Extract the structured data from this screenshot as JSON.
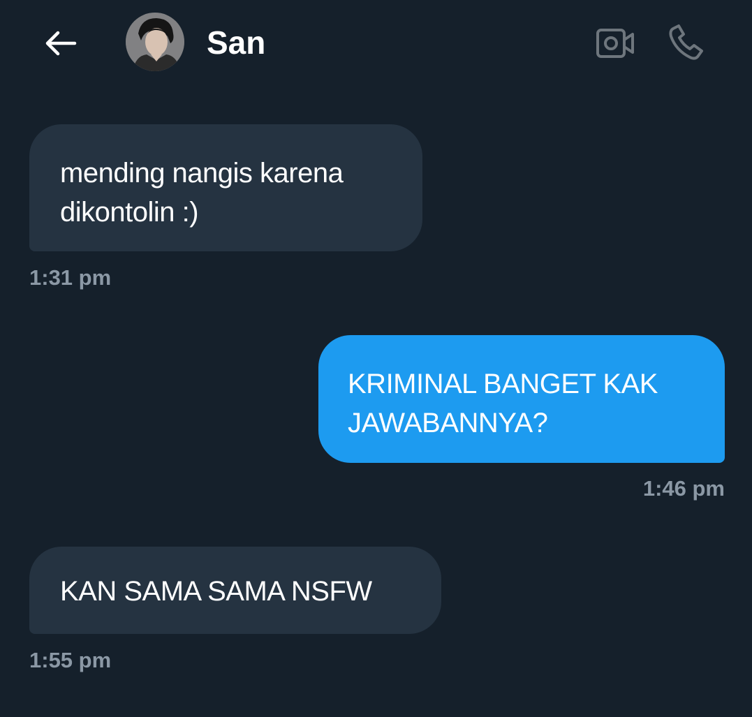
{
  "header": {
    "contact_name": "San",
    "icons": {
      "back": "arrow-left-icon",
      "video": "video-camera-icon",
      "call": "phone-icon"
    }
  },
  "colors": {
    "background": "#15202b",
    "received_bubble": "#253341",
    "sent_bubble": "#1d9bf0",
    "timestamp": "#8b98a5",
    "header_icon_muted": "#6e767d"
  },
  "messages": [
    {
      "direction": "received",
      "text": "mending nangis karena dikontolin :)",
      "time": "1:31 pm"
    },
    {
      "direction": "sent",
      "text": "KRIMINAL BANGET KAK JAWABANNYA?",
      "time": "1:46 pm"
    },
    {
      "direction": "received",
      "text": "KAN SAMA SAMA NSFW",
      "time": "1:55 pm"
    }
  ]
}
